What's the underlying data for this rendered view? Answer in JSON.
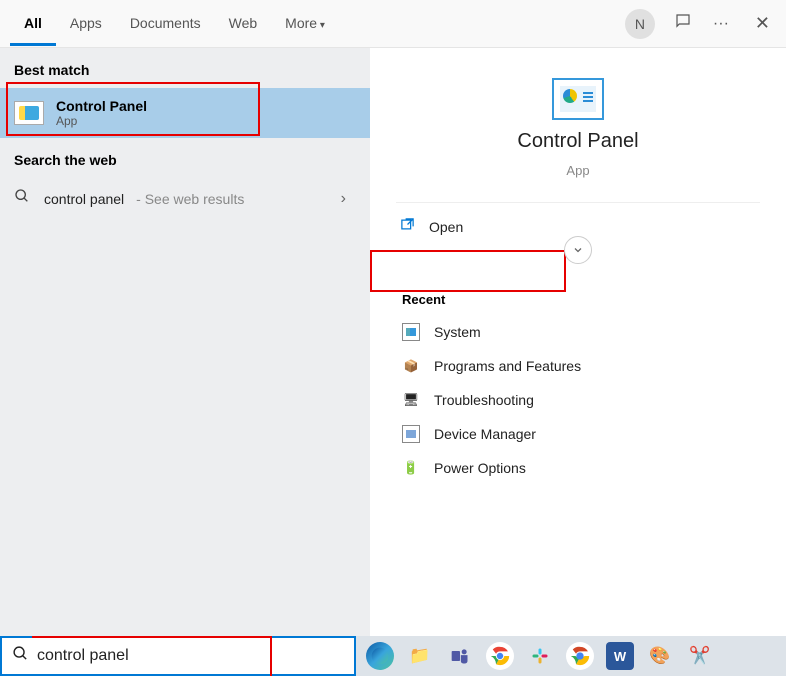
{
  "tabs": [
    "All",
    "Apps",
    "Documents",
    "Web",
    "More"
  ],
  "active_tab": "All",
  "avatar_initial": "N",
  "left": {
    "best_match_label": "Best match",
    "result": {
      "title": "Control Panel",
      "subtitle": "App"
    },
    "search_web_label": "Search the web",
    "web_result": {
      "query": "control panel",
      "suffix": " - See web results"
    }
  },
  "preview": {
    "title": "Control Panel",
    "subtitle": "App",
    "open_label": "Open",
    "recent_label": "Recent",
    "recent_items": [
      "System",
      "Programs and Features",
      "Troubleshooting",
      "Device Manager",
      "Power Options"
    ]
  },
  "search_value": "control panel"
}
